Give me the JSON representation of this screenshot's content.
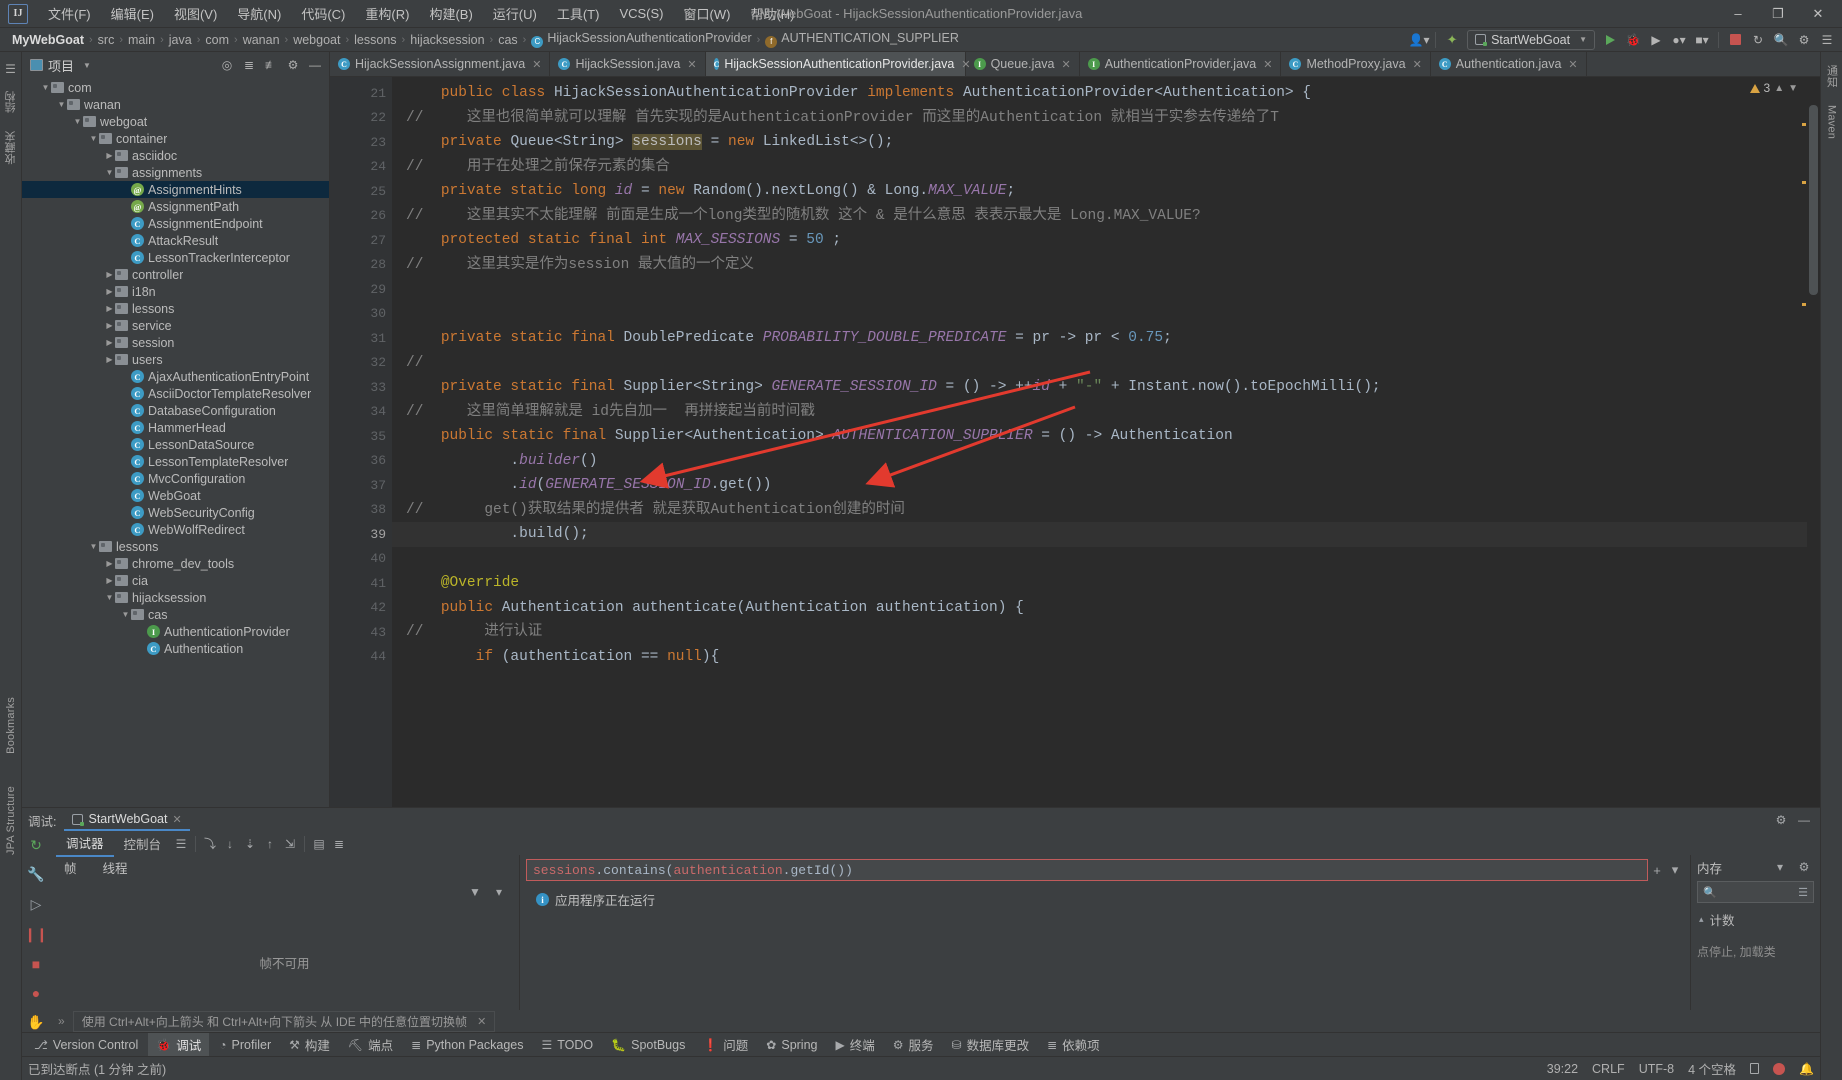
{
  "window": {
    "title": "MyWebGoat - HijackSessionAuthenticationProvider.java",
    "minimize": "–",
    "maximize": "❐",
    "close": "✕"
  },
  "menu": {
    "items": [
      "文件(F)",
      "编辑(E)",
      "视图(V)",
      "导航(N)",
      "代码(C)",
      "重构(R)",
      "构建(B)",
      "运行(U)",
      "工具(T)",
      "VCS(S)",
      "窗口(W)",
      "帮助(H)"
    ]
  },
  "breadcrumb": {
    "items": [
      {
        "label": "MyWebGoat",
        "icon": "none"
      },
      {
        "label": "src",
        "icon": "none"
      },
      {
        "label": "main",
        "icon": "none"
      },
      {
        "label": "java",
        "icon": "none"
      },
      {
        "label": "com",
        "icon": "none"
      },
      {
        "label": "wanan",
        "icon": "none"
      },
      {
        "label": "webgoat",
        "icon": "none"
      },
      {
        "label": "lessons",
        "icon": "none"
      },
      {
        "label": "hijacksession",
        "icon": "none"
      },
      {
        "label": "cas",
        "icon": "none"
      },
      {
        "label": "HijackSessionAuthenticationProvider",
        "icon": "class"
      },
      {
        "label": "AUTHENTICATION_SUPPLIER",
        "icon": "field"
      }
    ],
    "separator": "›"
  },
  "toolbar": {
    "run_config": "StartWebGoat",
    "search_icon": "search-icon",
    "settings_icon": "gear-icon",
    "run_icon": "run-icon",
    "debug_icon": "debug-icon",
    "stop_icon": "stop-icon"
  },
  "project_panel": {
    "title": "项目",
    "tree": [
      {
        "depth": 2,
        "label": "com",
        "type": "folder",
        "state": "open"
      },
      {
        "depth": 3,
        "label": "wanan",
        "type": "folder",
        "state": "open"
      },
      {
        "depth": 4,
        "label": "webgoat",
        "type": "folder",
        "state": "open"
      },
      {
        "depth": 5,
        "label": "container",
        "type": "folder",
        "state": "open"
      },
      {
        "depth": 6,
        "label": "asciidoc",
        "type": "folder",
        "state": "closed"
      },
      {
        "depth": 6,
        "label": "assignments",
        "type": "folder",
        "state": "open"
      },
      {
        "depth": 7,
        "label": "AssignmentHints",
        "type": "annotation",
        "selected": true
      },
      {
        "depth": 7,
        "label": "AssignmentPath",
        "type": "annotation"
      },
      {
        "depth": 7,
        "label": "AssignmentEndpoint",
        "type": "class"
      },
      {
        "depth": 7,
        "label": "AttackResult",
        "type": "class"
      },
      {
        "depth": 7,
        "label": "LessonTrackerInterceptor",
        "type": "class"
      },
      {
        "depth": 6,
        "label": "controller",
        "type": "folder",
        "state": "closed"
      },
      {
        "depth": 6,
        "label": "i18n",
        "type": "folder",
        "state": "closed"
      },
      {
        "depth": 6,
        "label": "lessons",
        "type": "folder",
        "state": "closed"
      },
      {
        "depth": 6,
        "label": "service",
        "type": "folder",
        "state": "closed"
      },
      {
        "depth": 6,
        "label": "session",
        "type": "folder",
        "state": "closed"
      },
      {
        "depth": 6,
        "label": "users",
        "type": "folder",
        "state": "closed"
      },
      {
        "depth": 7,
        "label": "AjaxAuthenticationEntryPoint",
        "type": "class"
      },
      {
        "depth": 7,
        "label": "AsciiDoctorTemplateResolver",
        "type": "class"
      },
      {
        "depth": 7,
        "label": "DatabaseConfiguration",
        "type": "class"
      },
      {
        "depth": 7,
        "label": "HammerHead",
        "type": "class"
      },
      {
        "depth": 7,
        "label": "LessonDataSource",
        "type": "class"
      },
      {
        "depth": 7,
        "label": "LessonTemplateResolver",
        "type": "class"
      },
      {
        "depth": 7,
        "label": "MvcConfiguration",
        "type": "class"
      },
      {
        "depth": 7,
        "label": "WebGoat",
        "type": "class-run"
      },
      {
        "depth": 7,
        "label": "WebSecurityConfig",
        "type": "class"
      },
      {
        "depth": 7,
        "label": "WebWolfRedirect",
        "type": "class"
      },
      {
        "depth": 5,
        "label": "lessons",
        "type": "folder",
        "state": "open"
      },
      {
        "depth": 6,
        "label": "chrome_dev_tools",
        "type": "folder",
        "state": "closed"
      },
      {
        "depth": 6,
        "label": "cia",
        "type": "folder",
        "state": "closed"
      },
      {
        "depth": 6,
        "label": "hijacksession",
        "type": "folder",
        "state": "open"
      },
      {
        "depth": 7,
        "label": "cas",
        "type": "folder",
        "state": "open"
      },
      {
        "depth": 8,
        "label": "AuthenticationProvider",
        "type": "interface"
      },
      {
        "depth": 8,
        "label": "Authentication",
        "type": "class"
      }
    ]
  },
  "editor": {
    "tabs": [
      {
        "label": "HijackSessionAssignment.java",
        "icon": "class",
        "active": false
      },
      {
        "label": "HijackSession.java",
        "icon": "class",
        "active": false
      },
      {
        "label": "HijackSessionAuthenticationProvider.java",
        "icon": "class",
        "active": true
      },
      {
        "label": "Queue.java",
        "icon": "interface",
        "active": false
      },
      {
        "label": "AuthenticationProvider.java",
        "icon": "interface",
        "active": false
      },
      {
        "label": "MethodProxy.java",
        "icon": "class",
        "active": false
      },
      {
        "label": "Authentication.java",
        "icon": "class",
        "active": false
      }
    ],
    "close_glyph": "✕",
    "warning_count": "3",
    "lines": [
      {
        "num": 21,
        "current": false,
        "tokens": [
          {
            "t": "    ",
            "c": "t"
          },
          {
            "t": "public ",
            "c": "k"
          },
          {
            "t": "class ",
            "c": "k"
          },
          {
            "t": "HijackSessionAuthenticationProvider ",
            "c": "cn"
          },
          {
            "t": "implements ",
            "c": "k"
          },
          {
            "t": "AuthenticationProvider<Authentication> {",
            "c": "cn"
          }
        ]
      },
      {
        "num": 22,
        "current": false,
        "tokens": [
          {
            "t": "//     这里也很简单就可以理解 首先实现的是AuthenticationProvider 而这里的Authentication 就相当于实参去传递给了T",
            "c": "cm"
          }
        ]
      },
      {
        "num": 23,
        "current": false,
        "tokens": [
          {
            "t": "    ",
            "c": "t"
          },
          {
            "t": "private ",
            "c": "k"
          },
          {
            "t": "Queue<String> ",
            "c": "cn"
          },
          {
            "t": "sessions",
            "c": "hlsel"
          },
          {
            "t": " = ",
            "c": "cn"
          },
          {
            "t": "new ",
            "c": "k"
          },
          {
            "t": "LinkedList<>();",
            "c": "cn"
          }
        ]
      },
      {
        "num": 24,
        "current": false,
        "tokens": [
          {
            "t": "//     用于在处理之前保存元素的集合",
            "c": "cm"
          }
        ]
      },
      {
        "num": 25,
        "current": false,
        "tokens": [
          {
            "t": "    ",
            "c": "t"
          },
          {
            "t": "private static ",
            "c": "k"
          },
          {
            "t": "long ",
            "c": "k"
          },
          {
            "t": "id",
            "c": "f"
          },
          {
            "t": " = ",
            "c": "cn"
          },
          {
            "t": "new ",
            "c": "k"
          },
          {
            "t": "Random().nextLong() & Long.",
            "c": "cn"
          },
          {
            "t": "MAX_VALUE",
            "c": "f"
          },
          {
            "t": ";",
            "c": "cn"
          }
        ]
      },
      {
        "num": 26,
        "current": false,
        "tokens": [
          {
            "t": "//     这里其实不太能理解 前面是生成一个long类型的随机数 这个 & 是什么意思 表表示最大是 Long.MAX_VALUE?",
            "c": "cm"
          }
        ]
      },
      {
        "num": 27,
        "current": false,
        "tokens": [
          {
            "t": "    ",
            "c": "t"
          },
          {
            "t": "protected static final ",
            "c": "k"
          },
          {
            "t": "int ",
            "c": "k"
          },
          {
            "t": "MAX_SESSIONS",
            "c": "f"
          },
          {
            "t": " = ",
            "c": "cn"
          },
          {
            "t": "50",
            "c": "n"
          },
          {
            "t": " ;",
            "c": "cn"
          }
        ]
      },
      {
        "num": 28,
        "current": false,
        "tokens": [
          {
            "t": "//     这里其实是作为session 最大值的一个定义",
            "c": "cm"
          }
        ]
      },
      {
        "num": 29,
        "current": false,
        "tokens": []
      },
      {
        "num": 30,
        "current": false,
        "tokens": []
      },
      {
        "num": 31,
        "current": false,
        "tokens": [
          {
            "t": "    ",
            "c": "t"
          },
          {
            "t": "private static final ",
            "c": "k"
          },
          {
            "t": "DoublePredicate ",
            "c": "cn"
          },
          {
            "t": "PROBABILITY_DOUBLE_PREDICATE",
            "c": "f"
          },
          {
            "t": " = pr -> pr < ",
            "c": "cn"
          },
          {
            "t": "0.75",
            "c": "n"
          },
          {
            "t": ";",
            "c": "cn"
          }
        ]
      },
      {
        "num": 32,
        "current": false,
        "tokens": [
          {
            "t": "//",
            "c": "cm"
          }
        ]
      },
      {
        "num": 33,
        "current": false,
        "tokens": [
          {
            "t": "    ",
            "c": "t"
          },
          {
            "t": "private static final ",
            "c": "k"
          },
          {
            "t": "Supplier<String> ",
            "c": "cn"
          },
          {
            "t": "GENERATE_SESSION_ID",
            "c": "f"
          },
          {
            "t": " = () -> ++",
            "c": "cn"
          },
          {
            "t": "id",
            "c": "f"
          },
          {
            "t": " + ",
            "c": "cn"
          },
          {
            "t": "\"-\"",
            "c": "s"
          },
          {
            "t": " + Instant.",
            "c": "cn"
          },
          {
            "t": "now",
            "c": "cn"
          },
          {
            "t": "().toEpochMilli();",
            "c": "cn"
          }
        ]
      },
      {
        "num": 34,
        "current": false,
        "tokens": [
          {
            "t": "//     这里简单理解就是 id先自加一  再拼接起当前时间戳",
            "c": "cm"
          }
        ]
      },
      {
        "num": 35,
        "current": false,
        "tokens": [
          {
            "t": "    ",
            "c": "t"
          },
          {
            "t": "public static final ",
            "c": "k"
          },
          {
            "t": "Supplier<Authentication> ",
            "c": "cn"
          },
          {
            "t": "AUTHENTICATION_SUPPLIER",
            "c": "f"
          },
          {
            "t": " = () -> Authentication",
            "c": "cn"
          }
        ]
      },
      {
        "num": 36,
        "current": false,
        "tokens": [
          {
            "t": "            .",
            "c": "cn"
          },
          {
            "t": "builder",
            "c": "f"
          },
          {
            "t": "()",
            "c": "cn"
          }
        ]
      },
      {
        "num": 37,
        "current": false,
        "tokens": [
          {
            "t": "            .",
            "c": "cn"
          },
          {
            "t": "id",
            "c": "f"
          },
          {
            "t": "(",
            "c": "cn"
          },
          {
            "t": "GENERATE_SESSION_ID",
            "c": "f"
          },
          {
            "t": ".get())",
            "c": "cn"
          }
        ]
      },
      {
        "num": 38,
        "current": false,
        "tokens": [
          {
            "t": "//       get()获取结果的提供者 就是获取Authentication创建的时间",
            "c": "cm"
          }
        ]
      },
      {
        "num": 39,
        "current": true,
        "tokens": [
          {
            "t": "            .",
            "c": "cn"
          },
          {
            "t": "build",
            "c": "cn"
          },
          {
            "t": "();",
            "c": "cn"
          }
        ]
      },
      {
        "num": 40,
        "current": false,
        "tokens": []
      },
      {
        "num": 41,
        "current": false,
        "tokens": [
          {
            "t": "    ",
            "c": "t"
          },
          {
            "t": "@Override",
            "c": "an"
          }
        ]
      },
      {
        "num": 42,
        "current": false,
        "tokens": [
          {
            "t": "    ",
            "c": "t"
          },
          {
            "t": "public ",
            "c": "k"
          },
          {
            "t": "Authentication authenticate(Authentication authentication) {",
            "c": "cn"
          }
        ]
      },
      {
        "num": 43,
        "current": false,
        "tokens": [
          {
            "t": "//       进行认证",
            "c": "cm"
          }
        ]
      },
      {
        "num": 44,
        "current": false,
        "tokens": [
          {
            "t": "        ",
            "c": "t"
          },
          {
            "t": "if ",
            "c": "k"
          },
          {
            "t": "(authentication == ",
            "c": "cn"
          },
          {
            "t": "null",
            "c": "k"
          },
          {
            "t": "){",
            "c": "cn"
          }
        ]
      }
    ]
  },
  "debug": {
    "label": "调试:",
    "session_tab": "StartWebGoat",
    "tabs": [
      "调试器",
      "控制台"
    ],
    "frames_header": [
      "帧",
      "线程"
    ],
    "frames_empty": "帧不可用",
    "expression": "sessions.contains(authentication.getId())",
    "expr_tokens": [
      {
        "t": "sessions",
        "c": "red"
      },
      {
        "t": ".contains(",
        "c": "grey"
      },
      {
        "t": "authentication",
        "c": "red"
      },
      {
        "t": ".getId())",
        "c": "grey"
      }
    ],
    "running_message": "应用程序正在运行",
    "memory_title": "内存",
    "memory_count_label": "计数",
    "memory_note": "点停止, 加载类",
    "hint": "使用 Ctrl+Alt+向上箭头 和 Ctrl+Alt+向下箭头 从 IDE 中的任意位置切换帧"
  },
  "tool_windows": [
    {
      "label": "Version Control",
      "icon": "branch-icon",
      "active": false
    },
    {
      "label": "调试",
      "icon": "debug-icon",
      "active": true
    },
    {
      "label": "Profiler",
      "icon": "profiler-icon",
      "active": false
    },
    {
      "label": "构建",
      "icon": "hammer-icon",
      "active": false
    },
    {
      "label": "端点",
      "icon": "endpoints-icon",
      "active": false
    },
    {
      "label": "Python Packages",
      "icon": "packages-icon",
      "active": false
    },
    {
      "label": "TODO",
      "icon": "todo-icon",
      "active": false
    },
    {
      "label": "SpotBugs",
      "icon": "spotbugs-icon",
      "active": false
    },
    {
      "label": "问题",
      "icon": "problems-icon",
      "active": false
    },
    {
      "label": "Spring",
      "icon": "spring-icon",
      "active": false
    },
    {
      "label": "终端",
      "icon": "terminal-icon",
      "active": false
    },
    {
      "label": "服务",
      "icon": "services-icon",
      "active": false
    },
    {
      "label": "数据库更改",
      "icon": "database-icon",
      "active": false
    },
    {
      "label": "依赖项",
      "icon": "dependencies-icon",
      "active": false
    }
  ],
  "left_rail": [
    {
      "label": "结构",
      "icon": "structure-icon"
    },
    {
      "label": "收藏夹",
      "icon": "bookmarks-icon"
    }
  ],
  "right_rail": [
    {
      "label": "通知",
      "icon": "notifications-icon"
    },
    {
      "label": "Maven",
      "icon": "maven-icon"
    }
  ],
  "bottom_rail": [
    {
      "label": "Bookmarks"
    },
    {
      "label": "JPA Structure"
    }
  ],
  "status_bar": {
    "message": "已到达断点 (1 分钟 之前)",
    "caret": "39:22",
    "line_sep": "CRLF",
    "encoding": "UTF-8",
    "indent": "4 个空格"
  },
  "colors": {
    "accent": "#4a88c7",
    "bg": "#3c3f41",
    "editor_bg": "#2b2b2b",
    "selection": "#0d293e",
    "arrow_red": "#e03030",
    "keyword": "#cc7832",
    "string": "#6a8759",
    "number": "#6897bb",
    "field": "#9876aa",
    "comment": "#808080"
  }
}
